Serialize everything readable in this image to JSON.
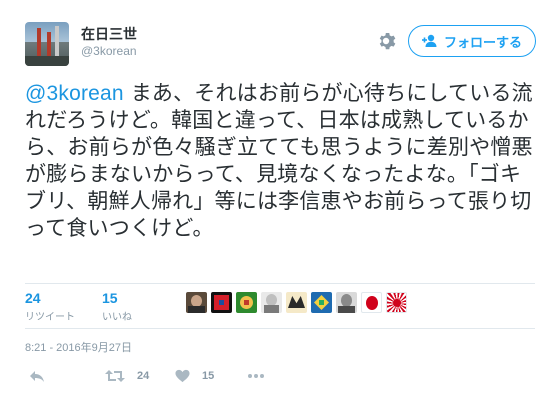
{
  "user": {
    "display_name": "在日三世",
    "handle": "@3korean"
  },
  "header": {
    "follow_label": "フォローする"
  },
  "tweet": {
    "mention": "@3korean",
    "text": " まあ、それはお前らが心待ちにしている流れだろうけど。韓国と違って、日本は成熟しているから、お前らが色々騒ぎ立てても思うように差別や憎悪が膨らまないからって、見境なくなったよな。「ゴキブリ、朝鮮人帰れ」等には李信恵やお前らって張り切って食いつくけど。"
  },
  "stats": {
    "retweets_count": "24",
    "retweets_label": "リツイート",
    "likes_count": "15",
    "likes_label": "いいね"
  },
  "likers": [
    {
      "icon": "liker-avatar-1"
    },
    {
      "icon": "liker-avatar-2"
    },
    {
      "icon": "liker-avatar-3"
    },
    {
      "icon": "liker-avatar-4"
    },
    {
      "icon": "liker-avatar-5"
    },
    {
      "icon": "liker-avatar-6"
    },
    {
      "icon": "liker-avatar-7"
    },
    {
      "icon": "liker-avatar-8"
    },
    {
      "icon": "liker-avatar-9"
    }
  ],
  "timestamp": "8:21 - 2016年9月27日",
  "actions": {
    "retweet_count": "24",
    "like_count": "15"
  },
  "colors": {
    "accent": "#1da1f2",
    "link": "#1b95e0",
    "muted": "#8899a6",
    "text": "#292f33"
  }
}
